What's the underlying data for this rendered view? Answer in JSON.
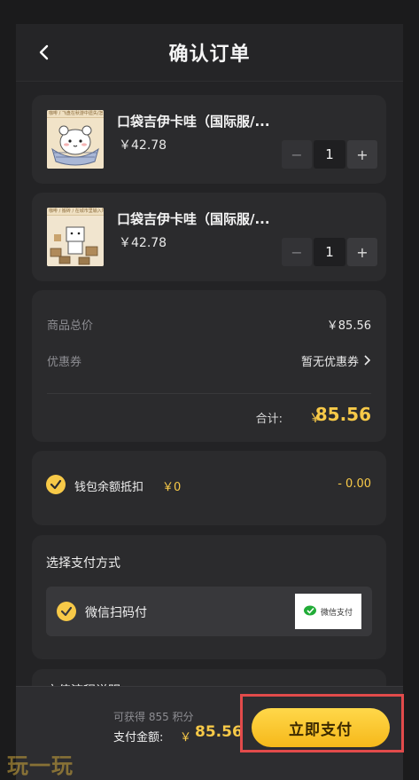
{
  "header": {
    "title": "确认订单"
  },
  "products": [
    {
      "name": "口袋吉伊卡哇（国际服/...",
      "price": "￥42.78",
      "quantity": "1",
      "thumb_caption": "咖啡 / 飞盘在秋游中遗失/怎么办"
    },
    {
      "name": "口袋吉伊卡哇（国际服/...",
      "price": "￥42.78",
      "quantity": "1",
      "thumb_caption": "咖啡 / 搬砖 / 在城市里输入地"
    }
  ],
  "summary": {
    "subtotal_label": "商品总价",
    "subtotal_value": "￥85.56",
    "coupon_label": "优惠券",
    "coupon_value": "暂无优惠券",
    "total_label": "合计:",
    "total_currency": "￥",
    "total_value": "85.56"
  },
  "wallet": {
    "label": "钱包余额抵扣",
    "balance": "￥0",
    "deduction": "- 0.00"
  },
  "payment": {
    "title": "选择支付方式",
    "option_label": "微信扫码付",
    "logo_text": "微信支付"
  },
  "partial_section_title": "充值流程说明",
  "footer": {
    "points_text": "可获得 855 积分",
    "amount_label": "支付金额:",
    "amount_currency": "￥",
    "amount_value": "85.56",
    "pay_button": "立即支付"
  },
  "watermark": "玩一玩",
  "colors": {
    "accent": "#f7c948",
    "background": "#1b1b1c",
    "card": "#2b2b2d",
    "highlight": "#e24b4b"
  },
  "icons": {
    "back": "chevron-left-icon",
    "check": "check-icon",
    "coupon_arrow": "chevron-right-icon",
    "wechat": "wechat-pay-icon"
  }
}
